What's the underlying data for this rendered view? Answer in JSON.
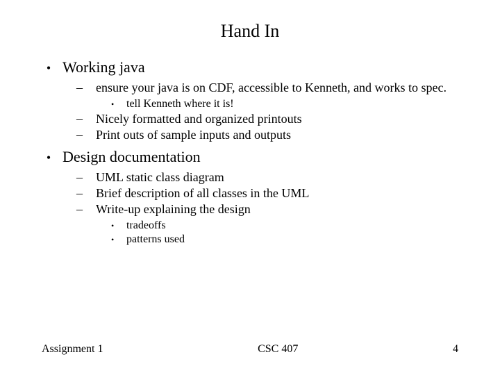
{
  "title": "Hand In",
  "items": [
    {
      "label": "Working java",
      "children": [
        {
          "label": "ensure your java is on CDF, accessible to Kenneth, and works to spec.",
          "children": [
            {
              "label": "tell Kenneth where it is!"
            }
          ]
        },
        {
          "label": "Nicely formatted and organized printouts"
        },
        {
          "label": "Print outs of sample inputs and outputs"
        }
      ]
    },
    {
      "label": "Design documentation",
      "children": [
        {
          "label": "UML static class diagram"
        },
        {
          "label": "Brief description of all classes in the UML"
        },
        {
          "label": "Write-up explaining the design",
          "children": [
            {
              "label": "tradeoffs"
            },
            {
              "label": "patterns used"
            }
          ]
        }
      ]
    }
  ],
  "footer": {
    "left": "Assignment 1",
    "center": "CSC 407",
    "right": "4"
  }
}
